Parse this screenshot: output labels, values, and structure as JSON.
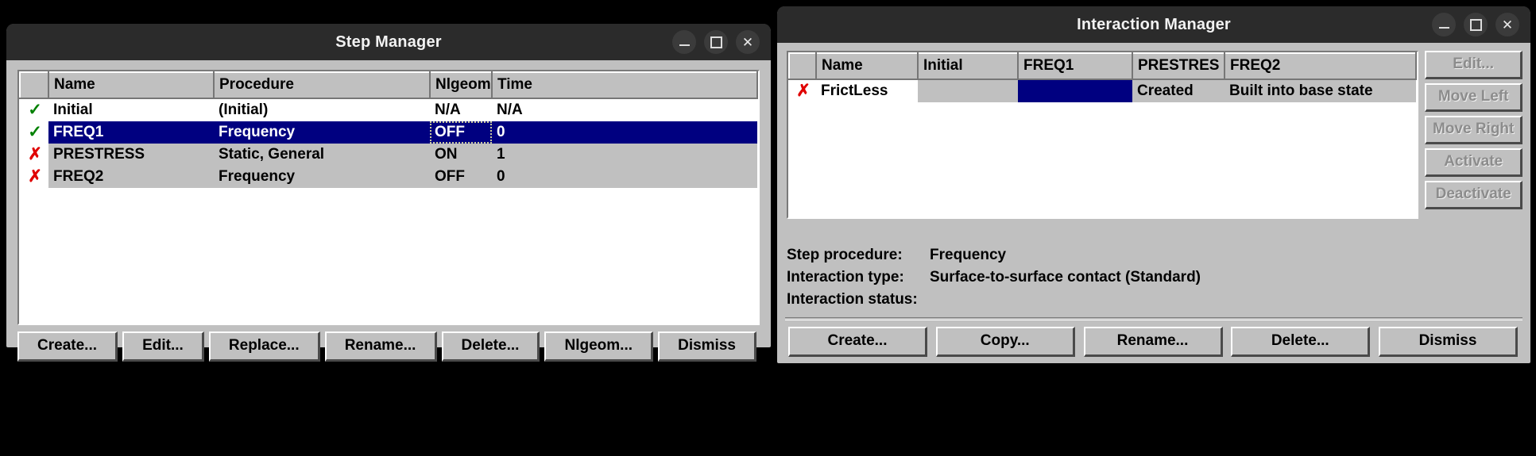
{
  "step_manager": {
    "title": "Step Manager",
    "window_controls": [
      {
        "name": "minimize",
        "glyph": "–"
      },
      {
        "name": "maximize",
        "glyph": "□"
      },
      {
        "name": "close",
        "glyph": "✕"
      }
    ],
    "columns": [
      "",
      "Name",
      "Procedure",
      "Nlgeom",
      "Time"
    ],
    "rows": [
      {
        "status": "check",
        "name": "Initial",
        "procedure": "(Initial)",
        "nlgeom": "N/A",
        "time": "N/A",
        "selected": false,
        "indent": false,
        "stripe": "white"
      },
      {
        "status": "check",
        "name": "FREQ1",
        "procedure": "Frequency",
        "nlgeom": "OFF",
        "time": "0",
        "selected": true,
        "indent": true,
        "stripe": "sel"
      },
      {
        "status": "cross",
        "name": "PRESTRESS",
        "procedure": "Static, General",
        "nlgeom": "ON",
        "time": "1",
        "selected": false,
        "indent": false,
        "stripe": "gray"
      },
      {
        "status": "cross",
        "name": "FREQ2",
        "procedure": "Frequency",
        "nlgeom": "OFF",
        "time": "0",
        "selected": false,
        "indent": true,
        "stripe": "gray"
      }
    ],
    "buttons": [
      "Create...",
      "Edit...",
      "Replace...",
      "Rename...",
      "Delete...",
      "Nlgeom...",
      "Dismiss"
    ]
  },
  "interaction_manager": {
    "title": "Interaction Manager",
    "window_controls": [
      {
        "name": "minimize",
        "glyph": "–"
      },
      {
        "name": "maximize",
        "glyph": "□"
      },
      {
        "name": "close",
        "glyph": "✕"
      }
    ],
    "columns": [
      "",
      "Name",
      "Initial",
      "FREQ1",
      "PRESTRES",
      "FREQ2"
    ],
    "rows": [
      {
        "status": "cross",
        "name": "FrictLess",
        "initial": "",
        "freq1": "",
        "prestress": "Created",
        "freq2": "Built into base state",
        "freq1_selected": true
      }
    ],
    "side_buttons": [
      {
        "label": "Edit...",
        "disabled": true
      },
      {
        "label": "Move Left",
        "disabled": true
      },
      {
        "label": "Move Right",
        "disabled": true
      },
      {
        "label": "Activate",
        "disabled": true
      },
      {
        "label": "Deactivate",
        "disabled": true
      }
    ],
    "info": [
      {
        "label": "Step procedure:",
        "value": "Frequency"
      },
      {
        "label": "Interaction type:",
        "value": "Surface-to-surface contact (Standard)"
      },
      {
        "label": "Interaction status:",
        "value": ""
      }
    ],
    "buttons": [
      "Create...",
      "Copy...",
      "Rename...",
      "Delete...",
      "Dismiss"
    ]
  },
  "colors": {
    "titlebar": "#2b2b2b",
    "face": "#c0c0c0",
    "selection": "#000080",
    "check": "#008000",
    "cross": "#e00000",
    "text": "#000000"
  }
}
